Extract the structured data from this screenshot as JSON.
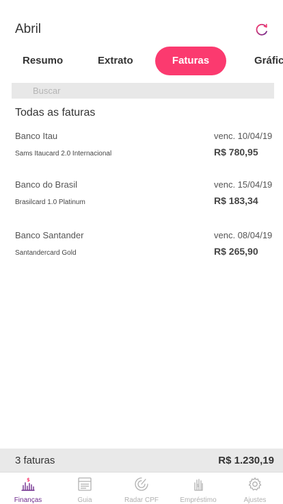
{
  "header": {
    "title": "Abril",
    "refresh_icon": "refresh-icon"
  },
  "tabs": [
    {
      "label": "Resumo"
    },
    {
      "label": "Extrato"
    },
    {
      "label": "Faturas",
      "active": true
    },
    {
      "label": "Gráfic"
    }
  ],
  "search": {
    "placeholder": "Buscar",
    "value": ""
  },
  "section_title": "Todas as faturas",
  "invoices": [
    {
      "bank": "Banco Itau",
      "card": "Sams Itaucard 2.0 Internacional",
      "due": "venc. 10/04/19",
      "amount": "R$ 780,95"
    },
    {
      "bank": "Banco do Brasil",
      "card": "Brasilcard 1.0 Platinum",
      "due": "venc. 15/04/19",
      "amount": "R$ 183,34"
    },
    {
      "bank": "Banco Santander",
      "card": "Santandercard Gold",
      "due": "venc. 08/04/19",
      "amount": "R$ 265,90"
    }
  ],
  "footer": {
    "count": "3 faturas",
    "total": "R$ 1.230,19"
  },
  "tabbar": [
    {
      "label": "Finanças",
      "icon": "finance-chart-icon",
      "active": true
    },
    {
      "label": "Guia",
      "icon": "guide-icon"
    },
    {
      "label": "Radar CPF",
      "icon": "radar-icon"
    },
    {
      "label": "Empréstimo",
      "icon": "hand-money-icon"
    },
    {
      "label": "Ajustes",
      "icon": "gear-icon"
    }
  ],
  "colors": {
    "accent": "#fb3a6f",
    "active_nav": "#6e2a8c",
    "inactive_nav": "#b0b0b0",
    "footer_bg": "#e9e9e9"
  }
}
